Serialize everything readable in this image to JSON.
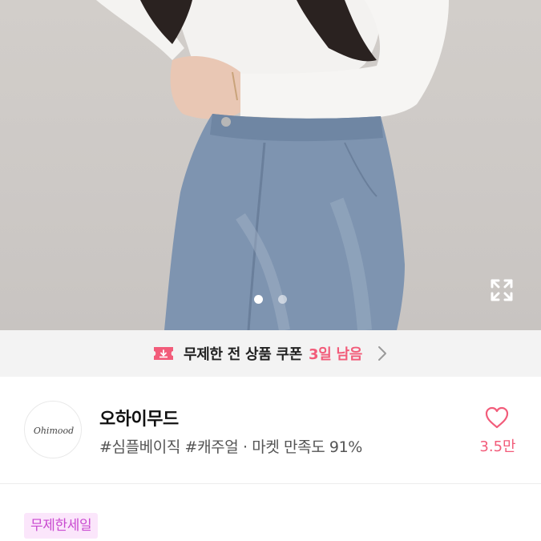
{
  "product_image": {
    "alt": "model wearing white top and blue jeans",
    "carousel": {
      "total": 2,
      "current": 1
    },
    "expand_icon": "expand-arrows-icon"
  },
  "coupon_banner": {
    "icon": "coupon-ticket-icon",
    "label": "무제한 전 상품 쿠폰",
    "days_left": "3일 남음",
    "chevron": "chevron-right-icon",
    "accent_color": "#f25c7a"
  },
  "shop": {
    "logo_text": "Ohimood",
    "name": "오하이무드",
    "tags": "#심플베이직 #캐주얼 · 마켓 만족도 91%",
    "like_icon": "heart-outline-icon",
    "like_count": "3.5만"
  },
  "badge": {
    "label": "무제한세일",
    "color": "#c94ad0",
    "background": "#fbe6fb"
  }
}
